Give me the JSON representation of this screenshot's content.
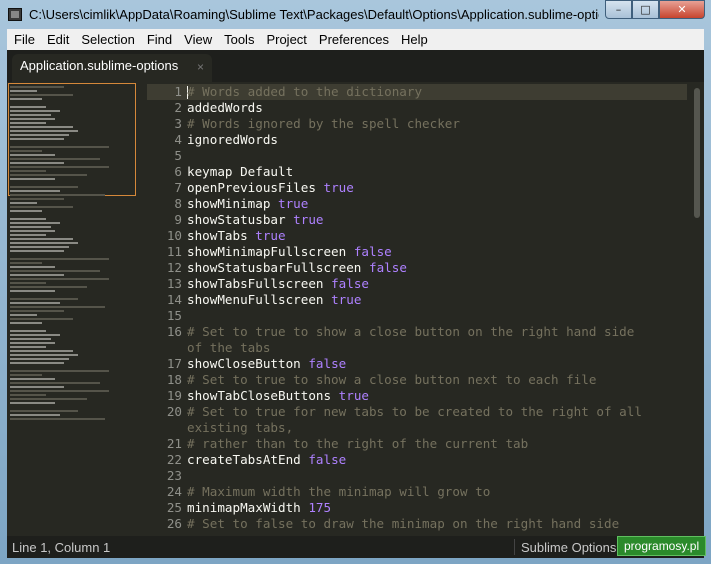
{
  "window": {
    "title": "C:\\Users\\cimlik\\AppData\\Roaming\\Sublime Text\\Packages\\Default\\Options\\Application.sublime-options - ...",
    "minimize_glyph": "–",
    "maximize_glyph": "□",
    "close_glyph": "✕"
  },
  "menu": [
    "File",
    "Edit",
    "Selection",
    "Find",
    "View",
    "Tools",
    "Project",
    "Preferences",
    "Help"
  ],
  "tab": {
    "label": "Application.sublime-options",
    "close_glyph": "×"
  },
  "gutter": [
    "1",
    "2",
    "3",
    "4",
    "5",
    "6",
    "7",
    "8",
    "9",
    "10",
    "11",
    "12",
    "13",
    "14",
    "15",
    "16",
    "",
    "17",
    "18",
    "19",
    "20",
    "",
    "21",
    "22",
    "23",
    "24",
    "25",
    "26"
  ],
  "code": {
    "l1": "# Words added to the dictionary",
    "l2": "addedWords",
    "l3": "# Words ignored by the spell checker",
    "l4": "ignoredWords",
    "l6": "keymap Default",
    "l7k": "openPreviousFiles",
    "l7v": "true",
    "l8k": "showMinimap",
    "l8v": "true",
    "l9k": "showStatusbar",
    "l9v": "true",
    "l10k": "showTabs",
    "l10v": "true",
    "l11k": "showMinimapFullscreen",
    "l11v": "false",
    "l12k": "showStatusbarFullscreen",
    "l12v": "false",
    "l13k": "showTabsFullscreen",
    "l13v": "false",
    "l14k": "showMenuFullscreen",
    "l14v": "true",
    "l16a": "# Set to true to show a close button on the right hand side",
    "l16b": "of the tabs",
    "l17k": "showCloseButton",
    "l17v": "false",
    "l18": "# Set to true to show a close button next to each file",
    "l19k": "showTabCloseButtons",
    "l19v": "true",
    "l20a": "# Set to true for new tabs to be created to the right of all",
    "l20b": "existing tabs,",
    "l21": "# rather than to the right of the current tab",
    "l22k": "createTabsAtEnd",
    "l22v": "false",
    "l24": "# Maximum width the minimap will grow to",
    "l25k": "minimapMaxWidth",
    "l25v": "175",
    "l26": "# Set to false to draw the minimap on the right hand side"
  },
  "status": {
    "position": "Line 1, Column 1",
    "syntax": "Sublime Options"
  },
  "watermark": "programosy.pl"
}
